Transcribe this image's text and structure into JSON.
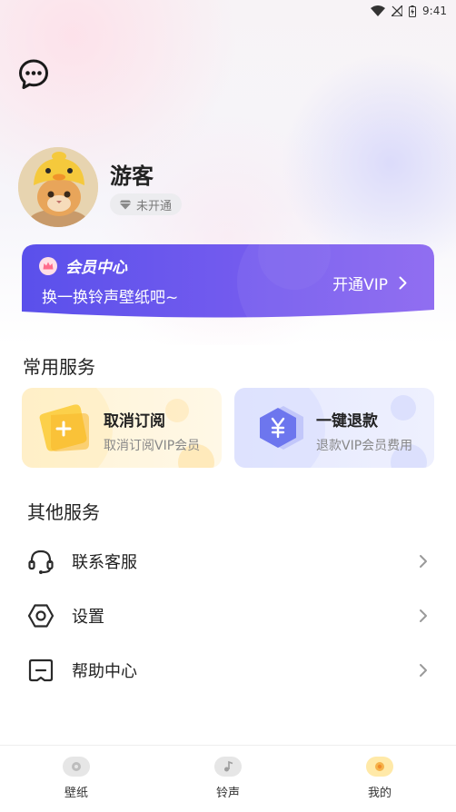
{
  "status_bar": {
    "time": "9:41"
  },
  "profile": {
    "username": "游客",
    "vip_status": "未开通"
  },
  "vip_card": {
    "title": "会员中心",
    "subtitle": "换一换铃声壁纸吧~",
    "cta": "开通VIP"
  },
  "common_services": {
    "title": "常用服务",
    "items": [
      {
        "name": "取消订阅",
        "desc": "取消订阅VIP会员"
      },
      {
        "name": "一键退款",
        "desc": "退款VIP会员费用"
      }
    ]
  },
  "other_services": {
    "title": "其他服务",
    "items": [
      {
        "label": "联系客服",
        "icon": "headset-icon"
      },
      {
        "label": "设置",
        "icon": "hexagon-settings-icon"
      },
      {
        "label": "帮助中心",
        "icon": "help-message-icon"
      }
    ]
  },
  "tabbar": {
    "items": [
      {
        "label": "壁纸",
        "icon": "wallpaper-icon",
        "active": false
      },
      {
        "label": "铃声",
        "icon": "ringtone-icon",
        "active": false
      },
      {
        "label": "我的",
        "icon": "profile-icon",
        "active": true
      }
    ]
  },
  "colors": {
    "vip_gradient_start": "#5b52ec",
    "vip_gradient_end": "#8a66f2",
    "cancel_card_bg": "#fff3d6",
    "refund_card_bg": "#e6e9fe",
    "active_tab": "#ffe9a8"
  }
}
